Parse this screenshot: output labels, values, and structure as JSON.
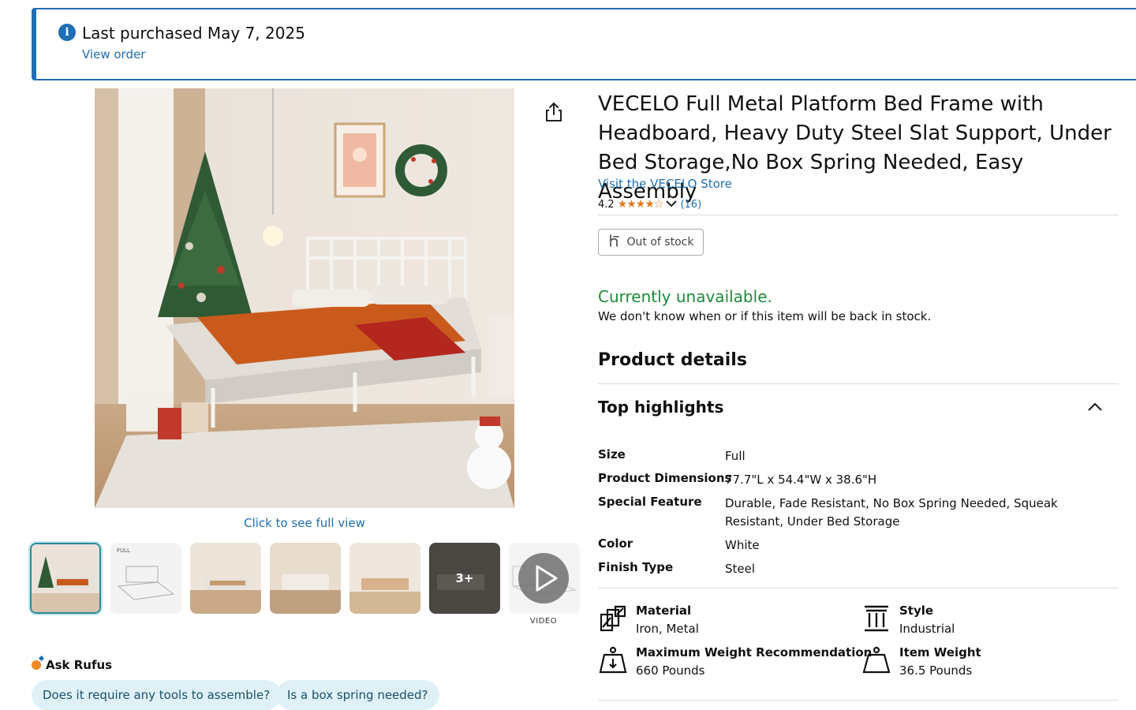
{
  "banner": {
    "title": "Last purchased May 7, 2025",
    "link": "View order",
    "icon": "info-icon",
    "color": "#1f6fb5"
  },
  "gallery": {
    "full_view": "Click to see full view",
    "more_count": "3+",
    "video_label": "VIDEO",
    "thumbnail_count": 7,
    "selected_index": 0
  },
  "rufus": {
    "title": "Ask Rufus",
    "chips": [
      "Does it require any tools to assemble?",
      "Is a box spring needed?"
    ]
  },
  "product": {
    "title": "VECELO Full Metal Platform Bed Frame with Headboard, Heavy Duty Steel Slat Support, Under Bed Storage,No Box Spring Needed, Easy Assembly",
    "store_link": "Visit the VECELO Store",
    "rating": "4.2",
    "stars": "★★★★☆",
    "stars_value": 4.2,
    "review_count": "(16)"
  },
  "availability": {
    "button": "Out of stock",
    "status": "Currently unavailable.",
    "message": "We don't know when or if this item will be back in stock.",
    "status_color": "#1f8a3a"
  },
  "details": {
    "heading": "Product details",
    "highlights_heading": "Top highlights",
    "specs": [
      {
        "key": "Size",
        "value": "Full"
      },
      {
        "key": "Product Dimensions",
        "value": "77.7\"L x 54.4\"W x 38.6\"H"
      },
      {
        "key": "Special Feature",
        "value": "Durable, Fade Resistant, No Box Spring Needed, Squeak Resistant, Under Bed Storage"
      },
      {
        "key": "Color",
        "value": "White"
      },
      {
        "key": "Finish Type",
        "value": "Steel"
      }
    ],
    "features": [
      {
        "key": "Material",
        "value": "Iron, Metal",
        "icon": "material-icon"
      },
      {
        "key": "Style",
        "value": "Industrial",
        "icon": "style-icon"
      },
      {
        "key": "Maximum Weight Recommendation",
        "value": "660 Pounds",
        "icon": "weight-recommendation-icon"
      },
      {
        "key": "Item Weight",
        "value": "36.5 Pounds",
        "icon": "item-weight-icon"
      }
    ]
  }
}
